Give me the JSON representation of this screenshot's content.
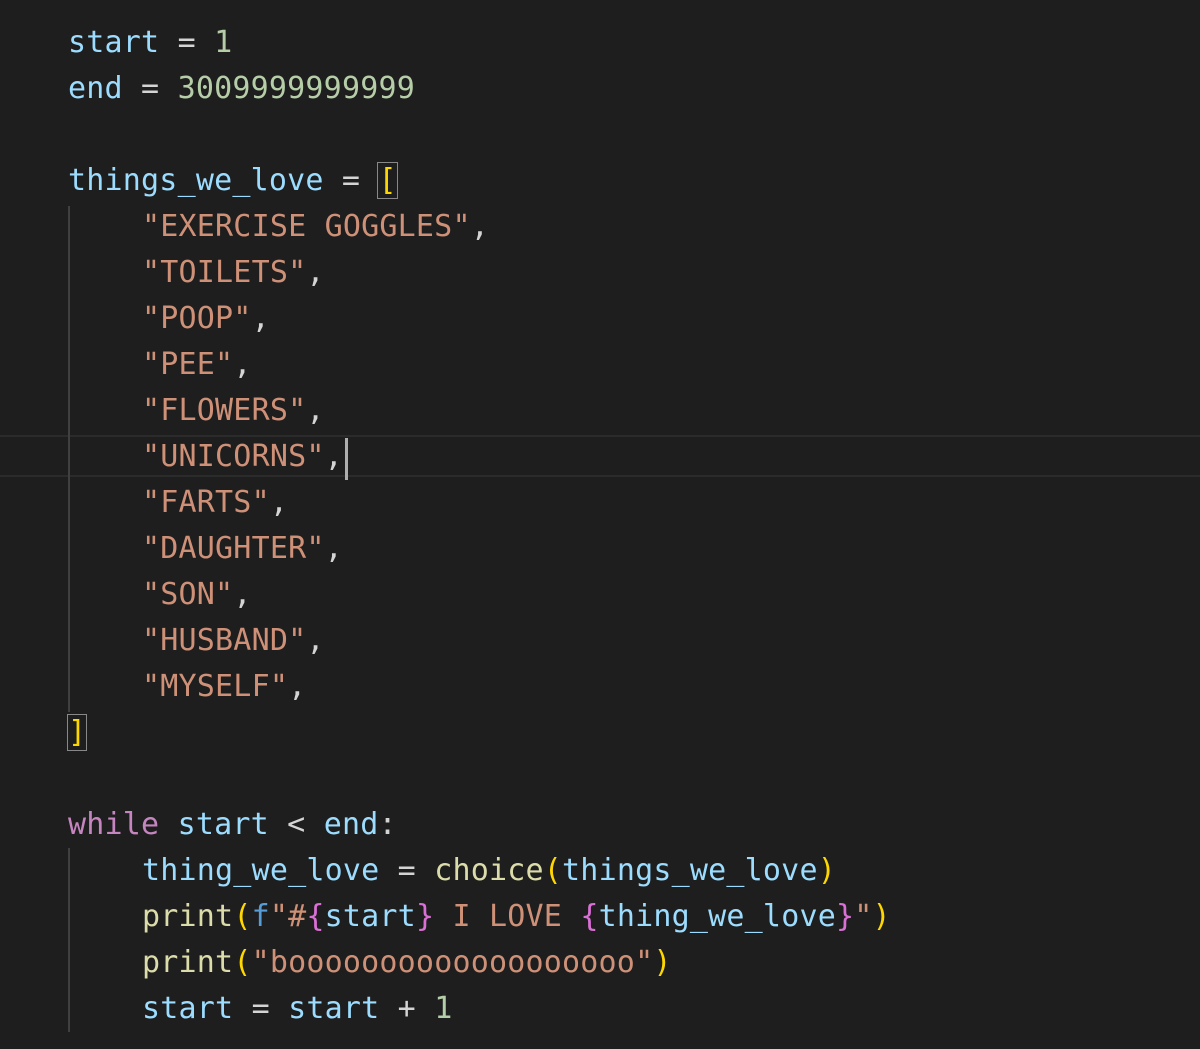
{
  "code": {
    "l1": {
      "var": "start",
      "eq": " = ",
      "val": "1"
    },
    "l2": {
      "var": "end",
      "eq": " = ",
      "val": "3009999999999"
    },
    "l3": {
      "var": "things_we_love",
      "eq": " = ",
      "open": "["
    },
    "items": [
      "\"EXERCISE GOGGLES\"",
      "\"TOILETS\"",
      "\"POOP\"",
      "\"PEE\"",
      "\"FLOWERS\"",
      "\"UNICORNS\"",
      "\"FARTS\"",
      "\"DAUGHTER\"",
      "\"SON\"",
      "\"HUSBAND\"",
      "\"MYSELF\""
    ],
    "comma": ",",
    "close": "]",
    "while_line": {
      "kw": "while",
      "a": "start",
      "lt": " < ",
      "b": "end",
      "colon": ":"
    },
    "body1": {
      "var": "thing_we_love",
      "eq": " = ",
      "fn": "choice",
      "open": "(",
      "arg": "things_we_love",
      "close": ")"
    },
    "body2": {
      "fn": "print",
      "open": "(",
      "prefix": "f",
      "s1": "\"#",
      "lb1": "{",
      "v1": "start",
      "rb1": "}",
      "s2": " I LOVE ",
      "lb2": "{",
      "v2": "thing_we_love",
      "rb2": "}",
      "s3": "\"",
      "close": ")"
    },
    "body3": {
      "fn": "print",
      "open": "(",
      "str": "\"booooooooooooooooooo\"",
      "close": ")"
    },
    "body4": {
      "var": "start",
      "eq": " = ",
      "var2": "start",
      "plus": " + ",
      "num": "1"
    }
  }
}
